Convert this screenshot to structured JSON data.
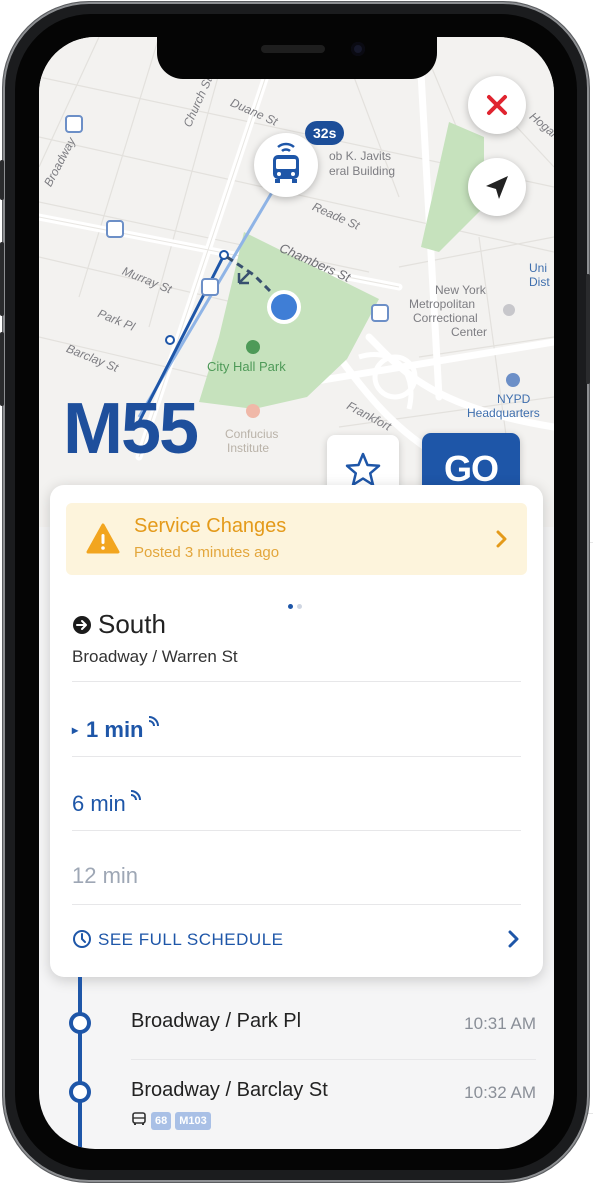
{
  "map": {
    "streets": [
      "Church St",
      "Duane St",
      "Reade St",
      "Chambers St",
      "Murray St",
      "Park Pl",
      "Barclay St",
      "Frankfort",
      "Broadway"
    ],
    "places": {
      "javits": "Jacob K. Javits Federal Building",
      "javits_l1": "ob K. Javits",
      "javits_l2": "eral Building",
      "city_hall_park": "City Hall Park",
      "mcc_l1": "New York",
      "mcc_l2": "Metropolitan",
      "mcc_l3": "Correctional",
      "mcc_l4": "Center",
      "confucius_l1": "Confucius",
      "confucius_l2": "Institute",
      "nypd_l1": "NYPD",
      "nypd_l2": "Headquarters",
      "uni_l1": "Uni",
      "uni_l2": "Dist",
      "hogan": "Hogan"
    },
    "bus_eta_badge": "32s",
    "icons": {
      "close": "close-icon",
      "locate": "location-arrow-icon",
      "bus": "bus-icon"
    }
  },
  "route": {
    "name": "M55",
    "go_label": "GO",
    "favorite_icon": "star-icon"
  },
  "alert": {
    "title": "Service Changes",
    "subtitle": "Posted 3 minutes ago"
  },
  "pager": {
    "count": 2,
    "active": 0
  },
  "direction": {
    "label": "South",
    "stop": "Broadway / Warren St"
  },
  "arrivals": [
    {
      "text": "1 min",
      "realtime": true,
      "next": true
    },
    {
      "text": "6 min",
      "realtime": true,
      "next": false
    },
    {
      "text": "12 min",
      "realtime": false,
      "next": false
    }
  ],
  "schedule_link": "SEE FULL SCHEDULE",
  "downstream_stops": [
    {
      "name": "Broadway / Park Pl",
      "time": "10:31 AM",
      "transfers": []
    },
    {
      "name": "Broadway / Barclay St",
      "time": "10:32 AM",
      "transfers": [
        "68",
        "M103"
      ]
    }
  ],
  "colors": {
    "brand": "#1e56a8",
    "route_title": "#1e4f9c",
    "alert_text": "#e49a1a",
    "alert_bg": "#fdf4dc",
    "close": "#e0242f",
    "park": "#c6e2bd",
    "scheduled": "#9ea7b5"
  }
}
